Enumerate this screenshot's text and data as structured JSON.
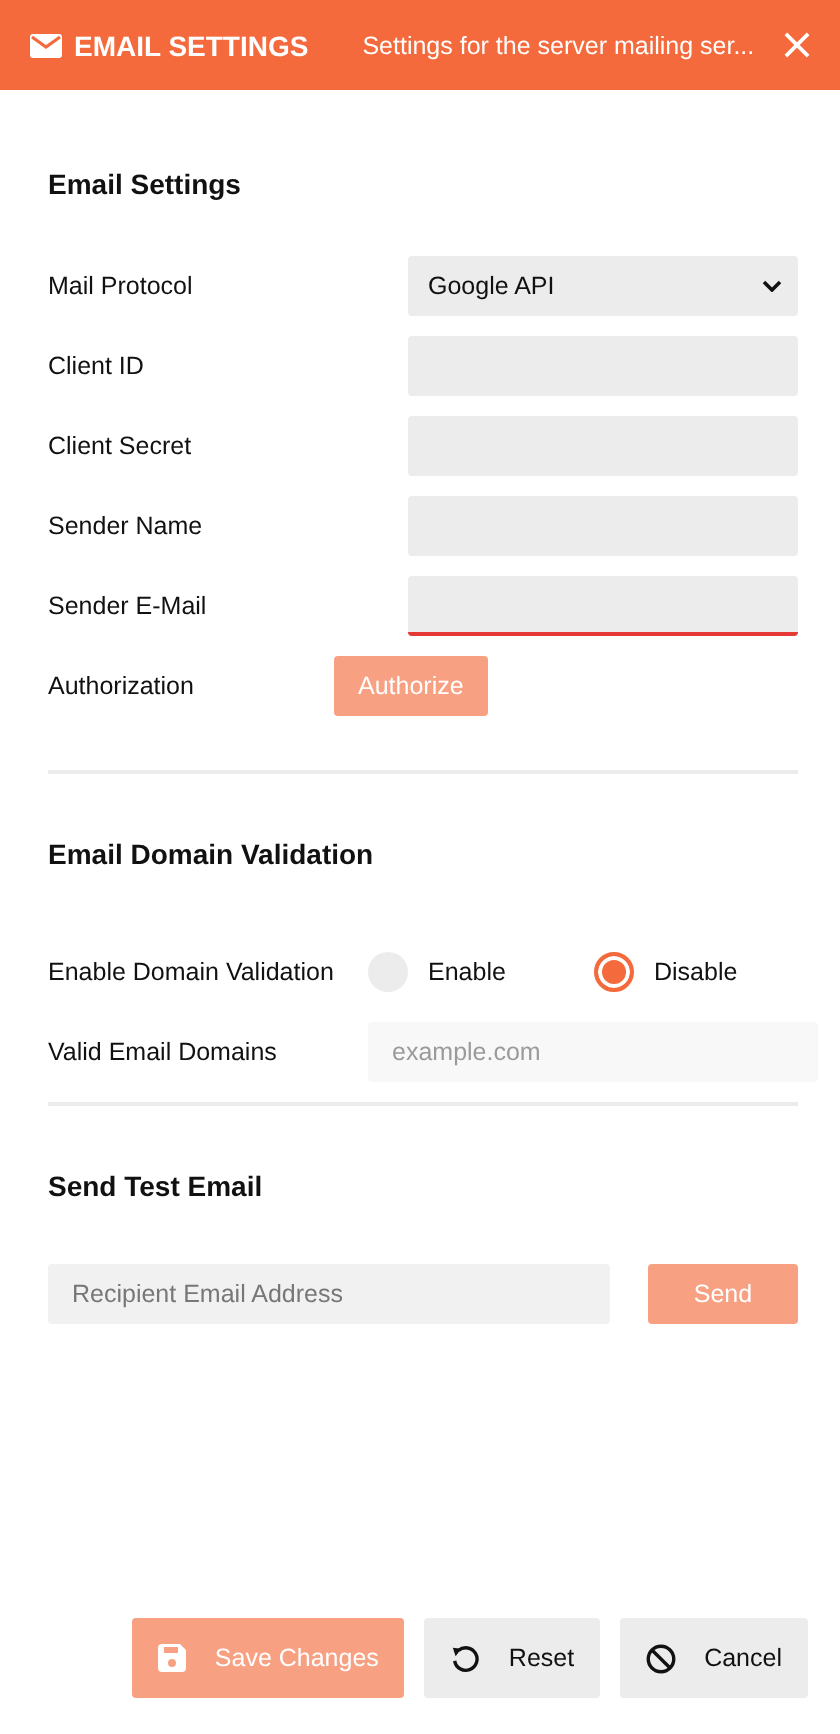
{
  "header": {
    "title": "EMAIL SETTINGS",
    "subtitle": "Settings for the server mailing ser..."
  },
  "sections": [
    {
      "title": "Email Settings",
      "rows": [
        {
          "kind": "select",
          "label": "Mail Protocol",
          "value": "Google API"
        },
        {
          "kind": "input",
          "label": "Client ID",
          "invalid": false
        },
        {
          "kind": "input",
          "label": "Client Secret",
          "invalid": false
        },
        {
          "kind": "input",
          "label": "Sender Name",
          "invalid": false
        },
        {
          "kind": "input",
          "label": "Sender E-Mail",
          "invalid": true
        },
        {
          "kind": "button",
          "label": "Authorization",
          "button": {
            "label": "Authorize",
            "disabled": true
          }
        }
      ]
    },
    {
      "title": "Email Domain Validation",
      "rows": [
        {
          "kind": "radio",
          "label": "Enable Domain Validation",
          "options": [
            {
              "label": "Enable",
              "selected": false
            },
            {
              "label": "Disable",
              "selected": true
            }
          ]
        },
        {
          "kind": "domains",
          "label": "Valid Email Domains",
          "placeholder": "example.com",
          "disabled": true
        }
      ]
    },
    {
      "title": "Send Test Email",
      "rows": [
        {
          "kind": "test",
          "placeholder": "Recipient Email Address",
          "button": {
            "label": "Send",
            "disabled": true
          }
        }
      ]
    }
  ],
  "footer": [
    {
      "kind": "save",
      "label": "Save Changes",
      "disabled": true
    },
    {
      "kind": "reset",
      "label": "Reset"
    },
    {
      "kind": "cancel",
      "label": "Cancel"
    }
  ]
}
